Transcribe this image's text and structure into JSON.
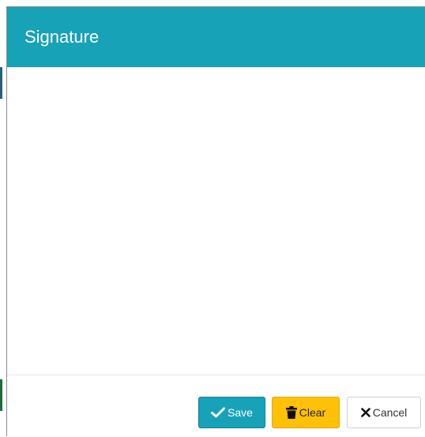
{
  "modal": {
    "title": "Signature",
    "header_color": "#17a2b8"
  },
  "footer": {
    "save": {
      "label": "Save",
      "icon": "check-icon",
      "color": "#17a2b8"
    },
    "clear": {
      "label": "Clear",
      "icon": "trash-icon",
      "color": "#ffc107"
    },
    "cancel": {
      "label": "Cancel",
      "icon": "close-icon",
      "color": "#ffffff"
    }
  }
}
